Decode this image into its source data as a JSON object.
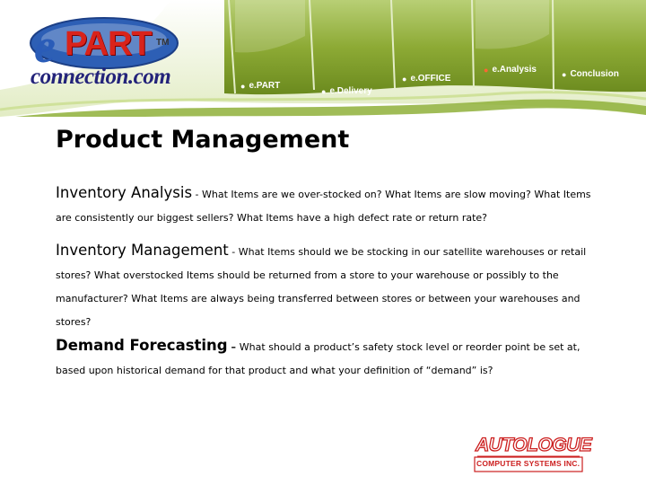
{
  "logo": {
    "e": "e",
    "part": "PART",
    "tm": "TM",
    "connection": "connection.com"
  },
  "nav": {
    "tabs": [
      {
        "label": "e.PART",
        "active": false
      },
      {
        "label": "e.Delivery",
        "active": false
      },
      {
        "label": "e.OFFICE",
        "active": false
      },
      {
        "label": "e.Analysis",
        "active": true
      },
      {
        "label": "Conclusion",
        "active": false
      }
    ]
  },
  "title": "Product Management",
  "sections": [
    {
      "heading": "Inventory Analysis",
      "separator": " - ",
      "body": "What Items are we over-stocked on? What Items are slow moving? What Items are consistently our biggest sellers? What Items have a high defect rate or return rate?"
    },
    {
      "heading": "Inventory Management",
      "separator": " - ",
      "body": "What Items should we be stocking in our satellite warehouses or retail stores? What overstocked Items should be returned from a store to your warehouse or possibly to the manufacturer? What Items are always being transferred between stores or between your warehouses and stores?"
    },
    {
      "heading": "Demand Forecasting",
      "separator": " – ",
      "body": "What should a product’s safety stock level or reorder point be set at, based upon historical demand for that product and what your definition of “demand” is?"
    }
  ],
  "footer_logo": {
    "name": "AUTOLOGUE",
    "subtitle": "COMPUTER SYSTEMS INC."
  },
  "colors": {
    "green_dark": "#7a9a2a",
    "green_light": "#c9dd93",
    "brand_red": "#d9231b",
    "brand_blue": "#23237a"
  }
}
